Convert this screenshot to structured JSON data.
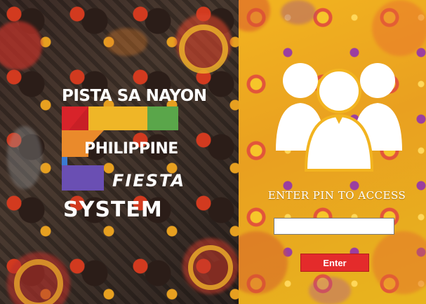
{
  "logo": {
    "line1": "PISTA SA NAYON",
    "line2": "PHILIPPINE",
    "line3": "FIESTA",
    "line4": "SYSTEM"
  },
  "login": {
    "prompt": "ENTER PIN TO ACCESS",
    "pin_value": "",
    "enter_label": "Enter"
  },
  "colors": {
    "logo_red": "#d8232a",
    "logo_yellow": "#efb627",
    "logo_green": "#5aa64a",
    "logo_orange": "#ea8a2b",
    "logo_blue": "#3b7bd2",
    "logo_purple": "#6a4fb3",
    "button_red": "#e42b2b",
    "panel_yellow": "#f2b420"
  },
  "icons": {
    "users": "users-group-icon"
  }
}
